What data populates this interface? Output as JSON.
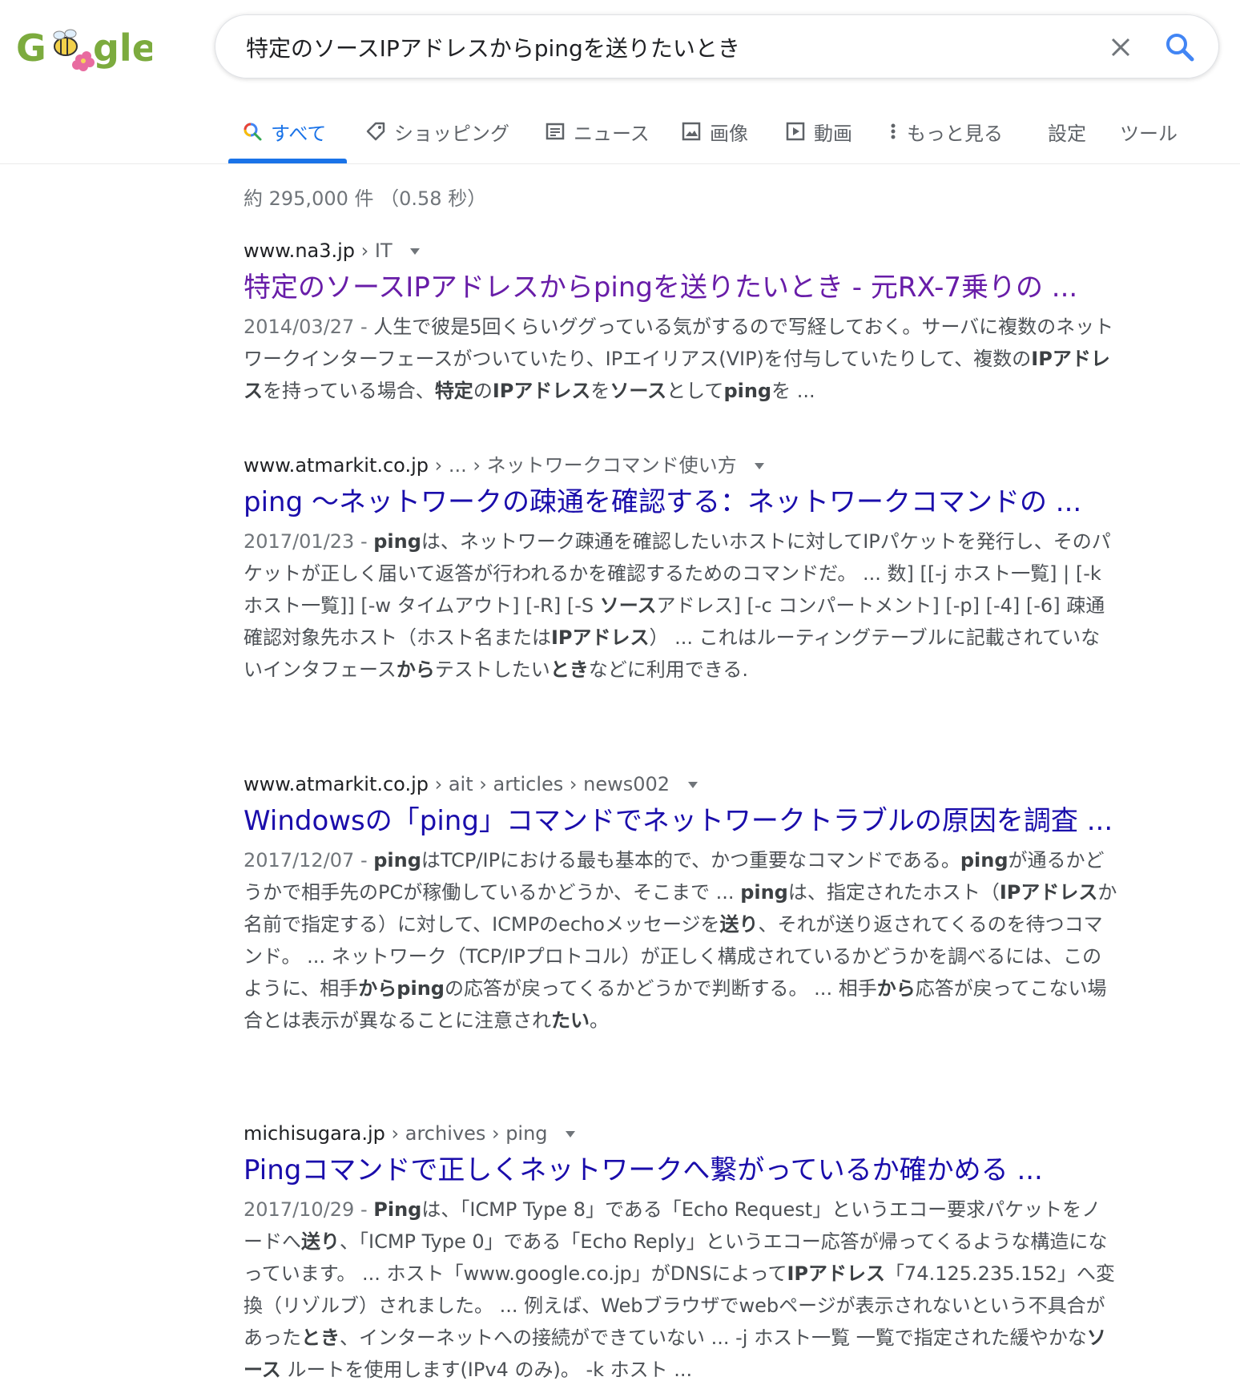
{
  "logo": {
    "alt": "Google"
  },
  "search": {
    "query": "特定のソースIPアドレスからpingを送りたいとき"
  },
  "tabs": [
    {
      "label": "すべて",
      "icon": "search-icon",
      "active": true
    },
    {
      "label": "ショッピング",
      "icon": "tag-icon"
    },
    {
      "label": "ニュース",
      "icon": "news-icon"
    },
    {
      "label": "画像",
      "icon": "image-icon"
    },
    {
      "label": "動画",
      "icon": "video-icon"
    },
    {
      "label": "もっと見る",
      "icon": "more-vert-icon"
    },
    {
      "label": "設定"
    },
    {
      "label": "ツール"
    }
  ],
  "stats": "約 295,000 件 （0.58 秒）",
  "results": [
    {
      "domain": "www.na3.jp",
      "path": " › IT",
      "title": "特定のソースIPアドレスからpingを送りたいとき - 元RX-7乗りの ...",
      "visited": true,
      "date": "2014/03/27 - ",
      "snippet": [
        [
          "人生で彼是5回くらいググっている気がするので写経しておく。サーバに複数のネットワークインターフェースがついていたり、IPエイリアス(VIP)を付与していたりして、複数の",
          false
        ],
        [
          "IPアドレス",
          true
        ],
        [
          "を持っている場合、",
          false
        ],
        [
          "特定",
          true
        ],
        [
          "の",
          false
        ],
        [
          "IPアドレス",
          true
        ],
        [
          "を",
          false
        ],
        [
          "ソース",
          true
        ],
        [
          "として",
          false
        ],
        [
          "ping",
          true
        ],
        [
          "を ...",
          false
        ]
      ]
    },
    {
      "domain": "www.atmarkit.co.jp",
      "path": " › ... › ネットワークコマンド使い方",
      "title": "ping 〜ネットワークの疎通を確認する：ネットワークコマンドの ...",
      "visited": false,
      "date": "2017/01/23 - ",
      "snippet": [
        [
          "ping",
          true
        ],
        [
          "は、ネットワーク疎通を確認したいホストに対してIPパケットを発行し、そのパケットが正しく届いて返答が行われるかを確認するためのコマンドだ。 ... 数] [[-j ホスト一覧] | [-k ホスト一覧]] [-w タイムアウト] [-R] [-S ",
          false
        ],
        [
          "ソース",
          true
        ],
        [
          "アドレス] [-c コンパートメント] [-p] [-4] [-6] 疎通確認対象先ホスト（ホスト名または",
          false
        ],
        [
          "IPアドレス",
          true
        ],
        [
          "） ... これはルーティングテーブルに記載されていないインタフェース",
          false
        ],
        [
          "から",
          true
        ],
        [
          "テストしたい",
          false
        ],
        [
          "とき",
          true
        ],
        [
          "などに利用できる.",
          false
        ]
      ]
    },
    {
      "domain": "www.atmarkit.co.jp",
      "path": " › ait › articles › news002",
      "title": "Windowsの「ping」コマンドでネットワークトラブルの原因を調査 ...",
      "visited": false,
      "date": "2017/12/07 - ",
      "snippet": [
        [
          "ping",
          true
        ],
        [
          "はTCP/IPにおける最も基本的で、かつ重要なコマンドである。",
          false
        ],
        [
          "ping",
          true
        ],
        [
          "が通るかどうかで相手先のPCが稼働しているかどうか、そこまで ... ",
          false
        ],
        [
          "ping",
          true
        ],
        [
          "は、指定されたホスト（",
          false
        ],
        [
          "IPアドレス",
          true
        ],
        [
          "か名前で指定する）に対して、ICMPのechoメッセージを",
          false
        ],
        [
          "送り",
          true
        ],
        [
          "、それが送り返されてくるのを待つコマンド。 ... ネットワーク（TCP/IPプロトコル）が正しく構成されているかどうかを調べるには、このように、相手",
          false
        ],
        [
          "から",
          true
        ],
        [
          "ping",
          true
        ],
        [
          "の応答が戻ってくるかどうかで判断する。 ... 相手",
          false
        ],
        [
          "から",
          true
        ],
        [
          "応答が戻ってこない場合とは表示が異なることに注意され",
          false
        ],
        [
          "たい",
          true
        ],
        [
          "。",
          false
        ]
      ]
    },
    {
      "domain": "michisugara.jp",
      "path": " › archives › ping",
      "title": "Pingコマンドで正しくネットワークへ繋がっているか確かめる ...",
      "visited": false,
      "date": "2017/10/29 - ",
      "snippet": [
        [
          "Ping",
          true
        ],
        [
          "は、「ICMP Type 8」である「Echo Request」というエコー要求パケットをノードへ",
          false
        ],
        [
          "送り",
          true
        ],
        [
          "、「ICMP Type 0」である「Echo Reply」というエコー応答が帰ってくるような構造になっています。 ... ホスト「www.google.co.jp」がDNSによって",
          false
        ],
        [
          "IPアドレス",
          true
        ],
        [
          "「74.125.235.152」へ変換（リゾルブ）されました。 ... 例えば、Webブラウザでwebページが表示されないという不具合があった",
          false
        ],
        [
          "とき",
          true
        ],
        [
          "、インターネットへの接続ができていない ... -j ホスト一覧 一覧で指定された緩やかな",
          false
        ],
        [
          "ソース",
          true
        ],
        [
          " ルートを使用します(IPv4 のみ)。 -k ホスト ...",
          false
        ]
      ]
    }
  ]
}
